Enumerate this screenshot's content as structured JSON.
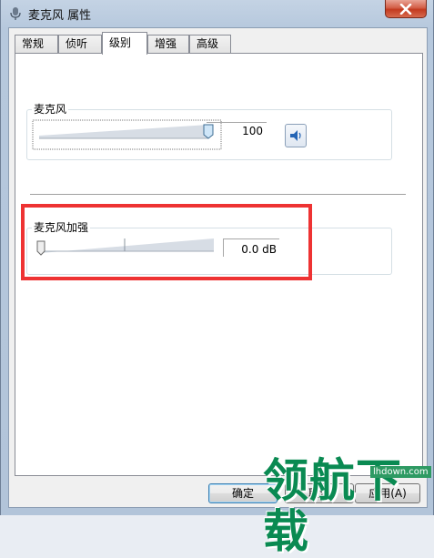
{
  "window": {
    "title": "麦克风 属性"
  },
  "tabs": [
    {
      "label": "常规",
      "active": false
    },
    {
      "label": "侦听",
      "active": false
    },
    {
      "label": "级别",
      "active": true
    },
    {
      "label": "增强",
      "active": false
    },
    {
      "label": "高级",
      "active": false
    }
  ],
  "microphone": {
    "label": "麦克风",
    "value": "100",
    "level_fraction": 1.0
  },
  "boost": {
    "label": "麦克风加强",
    "value": "0.0 dB",
    "level_fraction": 0.0
  },
  "buttons": {
    "ok": "确定",
    "cancel": "取消",
    "apply": "应用(A)"
  },
  "watermark": {
    "text": "领航下载",
    "url": "lhdown.com"
  },
  "colors": {
    "highlight": "#ee3333",
    "watermark": "#0a8a52"
  }
}
